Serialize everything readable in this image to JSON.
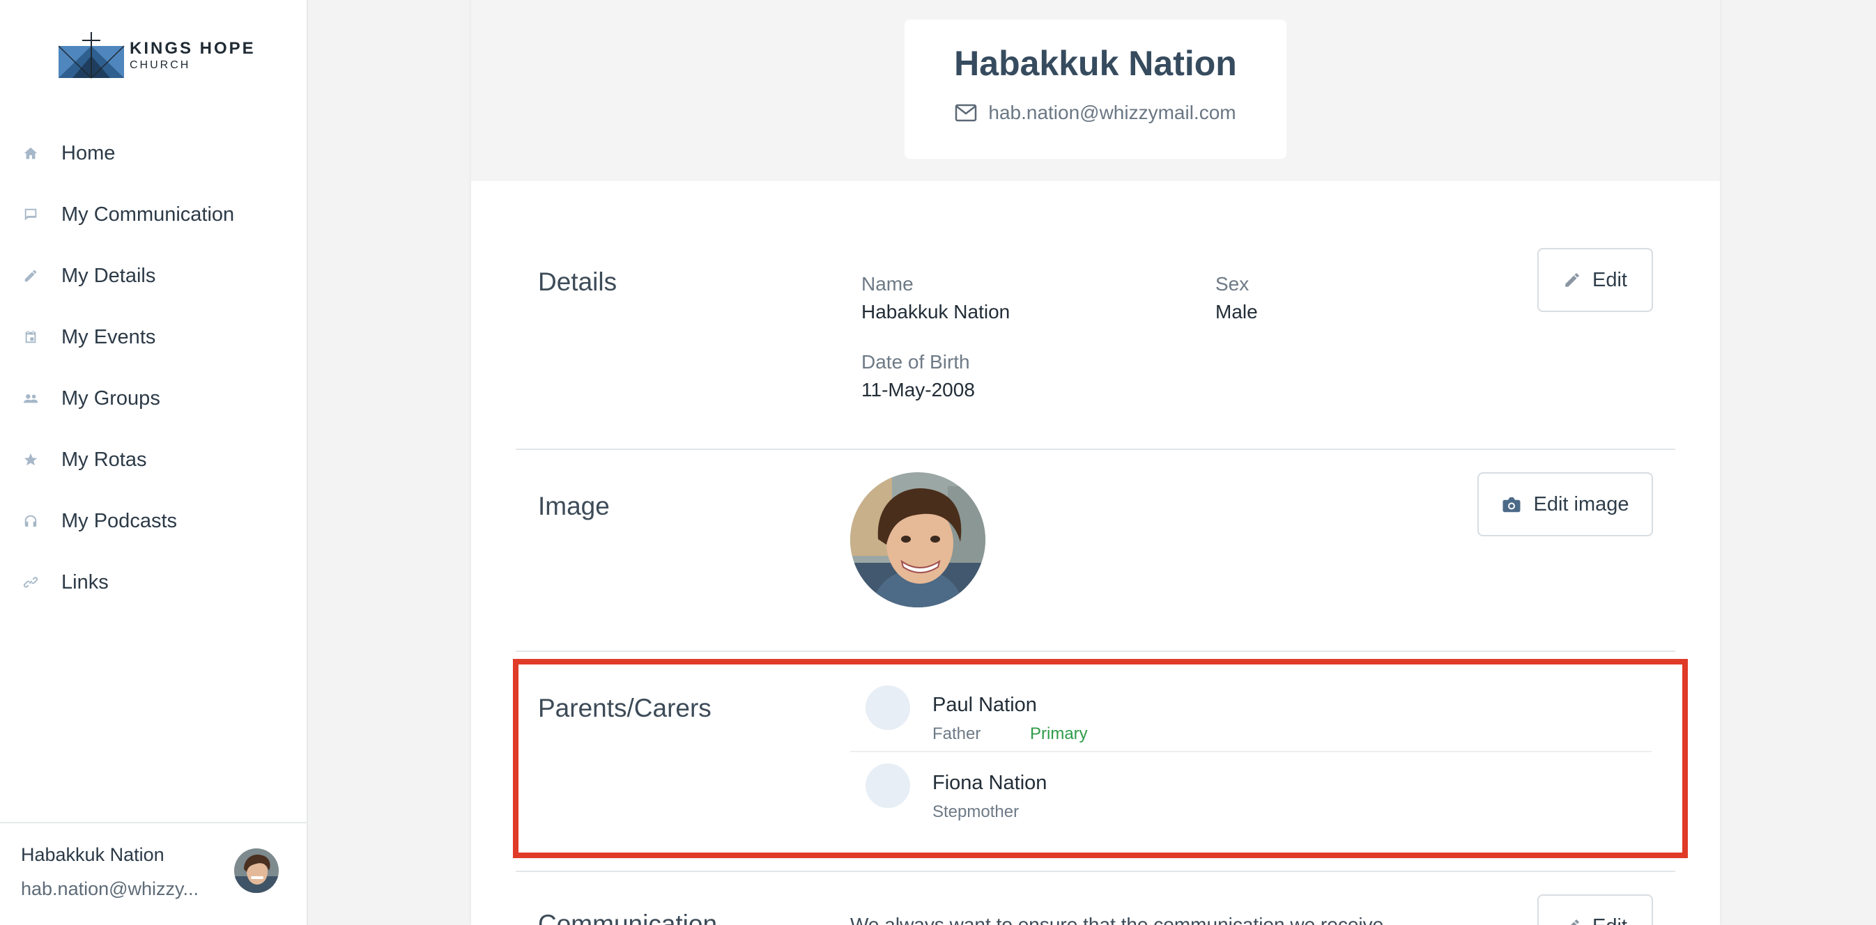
{
  "sidebar": {
    "logo": {
      "line1": "KINGS HOPE",
      "line2": "CHURCH"
    },
    "items": [
      {
        "label": "Home",
        "icon": "home-icon"
      },
      {
        "label": "My Communication",
        "icon": "chat-icon"
      },
      {
        "label": "My Details",
        "icon": "pencil-icon"
      },
      {
        "label": "My Events",
        "icon": "calendar-icon"
      },
      {
        "label": "My Groups",
        "icon": "people-icon"
      },
      {
        "label": "My Rotas",
        "icon": "star-icon"
      },
      {
        "label": "My Podcasts",
        "icon": "headphones-icon"
      },
      {
        "label": "Links",
        "icon": "link-icon"
      }
    ],
    "user": {
      "name": "Habakkuk Nation",
      "email": "hab.nation@whizzy..."
    }
  },
  "profile": {
    "name": "Habakkuk Nation",
    "email": "hab.nation@whizzymail.com"
  },
  "details": {
    "title": "Details",
    "name_label": "Name",
    "name_value": "Habakkuk Nation",
    "sex_label": "Sex",
    "sex_value": "Male",
    "dob_label": "Date of Birth",
    "dob_value": "11-May-2008",
    "edit_label": "Edit"
  },
  "image": {
    "title": "Image",
    "edit_label": "Edit image"
  },
  "carers": {
    "title": "Parents/Carers",
    "items": [
      {
        "name": "Paul Nation",
        "relation": "Father",
        "badge": "Primary"
      },
      {
        "name": "Fiona Nation",
        "relation": "Stepmother",
        "badge": ""
      }
    ]
  },
  "communication": {
    "title": "Communication",
    "text": "We always want to ensure that the communication we receive",
    "edit_label": "Edit"
  },
  "colors": {
    "accent": "#364b5e",
    "highlight": "#e03a28",
    "primary_badge": "#2e9b4a",
    "icon": "#a6b7c8"
  }
}
